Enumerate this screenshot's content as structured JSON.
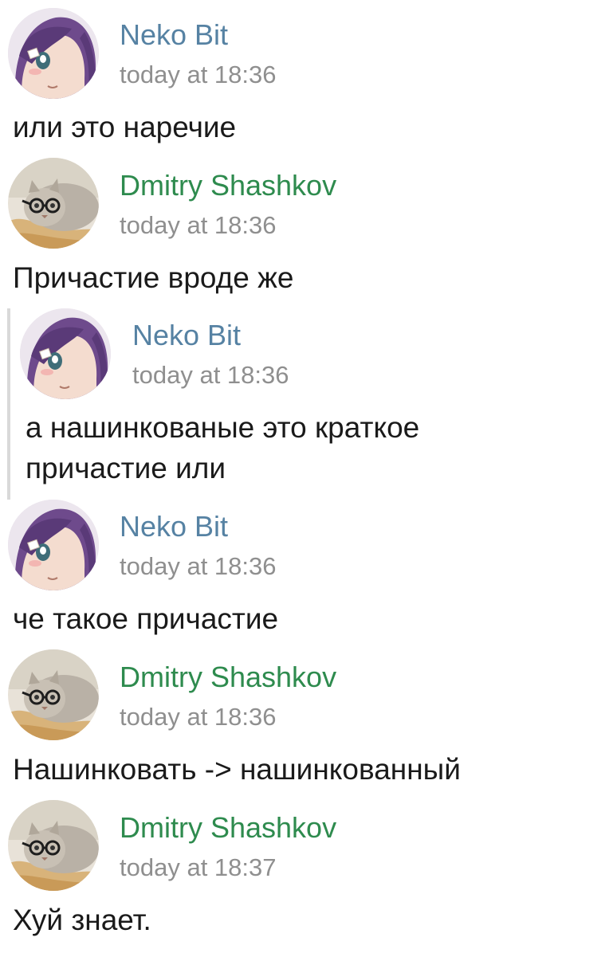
{
  "colors": {
    "neko_name": "#5682a3",
    "dmitry_name": "#2e8b4e",
    "time": "#8f8f8f",
    "text": "#1a1a1a",
    "forward_bar": "#d9d9d9"
  },
  "messages": [
    {
      "author": "Neko Bit",
      "avatar": "anime-girl-avatar",
      "time": "today at 18:36",
      "text": "или это наречие"
    },
    {
      "author": "Dmitry Shashkov",
      "avatar": "cat-glasses-avatar",
      "time": "today at 18:36",
      "text": "Причастие вроде же"
    },
    {
      "author": "Neko Bit",
      "avatar": "anime-girl-avatar",
      "time": "today at 18:36",
      "text_lines": [
        "а нашинкованые это краткое",
        "причастие или"
      ],
      "forwarded": true
    },
    {
      "author": "Neko Bit",
      "avatar": "anime-girl-avatar",
      "time": "today at 18:36",
      "text": "че такое причастие"
    },
    {
      "author": "Dmitry Shashkov",
      "avatar": "cat-glasses-avatar",
      "time": "today at 18:36",
      "text": "Нашинковать -> нашинкованный"
    },
    {
      "author": "Dmitry Shashkov",
      "avatar": "cat-glasses-avatar",
      "time": "today at 18:37",
      "text": "Хуй знает."
    }
  ]
}
